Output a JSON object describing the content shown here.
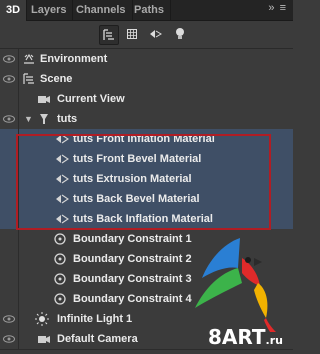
{
  "tabs": [
    {
      "label": "3D",
      "active": true
    },
    {
      "label": "Layers",
      "active": false
    },
    {
      "label": "Channels",
      "active": false
    },
    {
      "label": "Paths",
      "active": false
    }
  ],
  "toolbar": {
    "filters": [
      "scene-filter-icon",
      "mesh-filter-icon",
      "material-filter-icon",
      "light-filter-icon"
    ],
    "active_filter": "scene-filter-icon"
  },
  "tree": [
    {
      "label": "Environment",
      "icon": "environment-icon",
      "level": 0
    },
    {
      "label": "Scene",
      "icon": "scene-icon",
      "level": 0
    },
    {
      "label": "Current View",
      "icon": "camera-icon",
      "level": 1
    },
    {
      "label": "tuts",
      "icon": "mesh-icon",
      "level": 1,
      "expanded": true
    },
    {
      "label": "tuts Front Inflation Material",
      "icon": "material-icon",
      "level": 2,
      "selected": true
    },
    {
      "label": "tuts Front Bevel Material",
      "icon": "material-icon",
      "level": 2,
      "selected": true
    },
    {
      "label": "tuts Extrusion Material",
      "icon": "material-icon",
      "level": 2,
      "selected": true
    },
    {
      "label": "tuts Back Bevel Material",
      "icon": "material-icon",
      "level": 2,
      "selected": true
    },
    {
      "label": "tuts Back Inflation Material",
      "icon": "material-icon",
      "level": 2,
      "selected": true
    },
    {
      "label": "Boundary Constraint 1",
      "icon": "constraint-icon",
      "level": 2
    },
    {
      "label": "Boundary Constraint 2",
      "icon": "constraint-icon",
      "level": 2
    },
    {
      "label": "Boundary Constraint 3",
      "icon": "constraint-icon",
      "level": 2
    },
    {
      "label": "Boundary Constraint 4",
      "icon": "constraint-icon",
      "level": 2
    },
    {
      "label": "Infinite Light 1",
      "icon": "light-icon",
      "level": 1
    },
    {
      "label": "Default Camera",
      "icon": "camera-icon",
      "level": 1
    }
  ],
  "watermark": {
    "main": "8ART",
    "suffix": ".ru"
  },
  "colors": {
    "selection": "#3f4f66",
    "highlight_border": "#b01d24",
    "panel_bg": "#3b3b3b"
  }
}
